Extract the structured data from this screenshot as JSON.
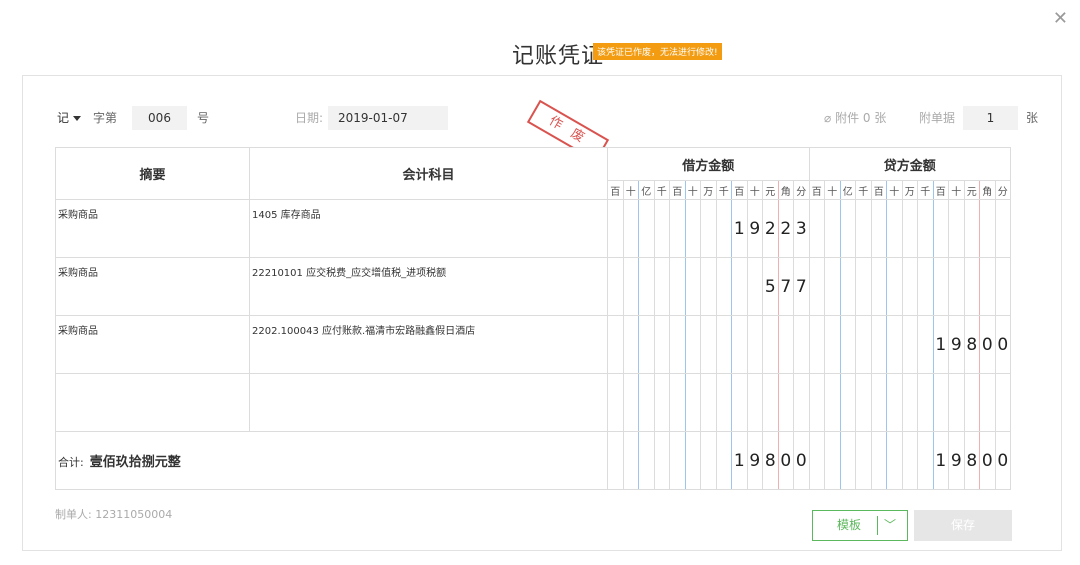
{
  "dialog": {
    "title": "记账凭证",
    "void_notice": "该凭证已作废，无法进行修改!",
    "stamp_text": "作 废",
    "close_icon": "close-icon"
  },
  "toolbar": {
    "voucher_word": "记",
    "word_suffix": "字第",
    "voucher_number": "006",
    "number_suffix": "号",
    "date_label": "日期:",
    "date_value": "2019-01-07",
    "attachment_label": "附件 0 张",
    "doc_count_label": "附单据",
    "doc_count_value": "1",
    "doc_count_unit": "张"
  },
  "table": {
    "headers": {
      "summary": "摘要",
      "account": "会计科目",
      "debit": "借方金额",
      "credit": "贷方金额"
    },
    "units": [
      "百",
      "十",
      "亿",
      "千",
      "百",
      "十",
      "万",
      "千",
      "百",
      "十",
      "元",
      "角",
      "分"
    ],
    "rows": [
      {
        "summary": "采购商品",
        "account": "1405 库存商品",
        "debit": "19223",
        "credit": ""
      },
      {
        "summary": "采购商品",
        "account": "22210101 应交税费_应交增值税_进项税额",
        "debit": "577",
        "credit": ""
      },
      {
        "summary": "采购商品",
        "account": "2202.100043 应付账款.福清市宏路融鑫假日酒店",
        "debit": "",
        "credit": "19800"
      },
      {
        "summary": "",
        "account": "",
        "debit": "",
        "credit": ""
      }
    ],
    "total": {
      "label": "合计:",
      "amount_words": "壹佰玖拾捌元整",
      "debit": "19800",
      "credit": "19800"
    }
  },
  "footer": {
    "maker_label": "制单人:",
    "maker_value": "12311050004",
    "template_button": "模板",
    "save_button": "保存"
  },
  "colors": {
    "accent_green": "#5cb85c",
    "void_orange": "#f39c12",
    "stamp_red": "#d9534f"
  }
}
